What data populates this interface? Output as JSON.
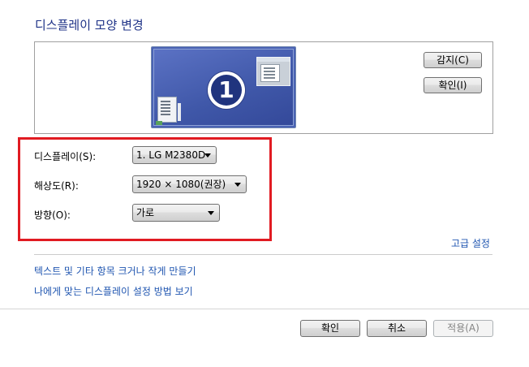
{
  "title": "디스플레이 모양 변경",
  "preview": {
    "monitor_number": "1",
    "buttons": {
      "detect": "감지(C)",
      "identify": "확인(I)"
    }
  },
  "settings": {
    "display": {
      "label": "디스플레이(S):",
      "value": "1. LG M2380D"
    },
    "resolution": {
      "label": "해상도(R):",
      "value": "1920 × 1080(권장)"
    },
    "orientation": {
      "label": "방향(O):",
      "value": "가로"
    }
  },
  "links": {
    "advanced": "고급 설정",
    "text_size": "텍스트 및 기타 항목 크거나 작게 만들기",
    "help": "나에게 맞는 디스플레이 설정 방법 보기"
  },
  "footer": {
    "ok": "확인",
    "cancel": "취소",
    "apply": "적용(A)"
  },
  "colors": {
    "title": "#1e3287",
    "link": "#1f55b0",
    "highlight": "#e11b22"
  }
}
